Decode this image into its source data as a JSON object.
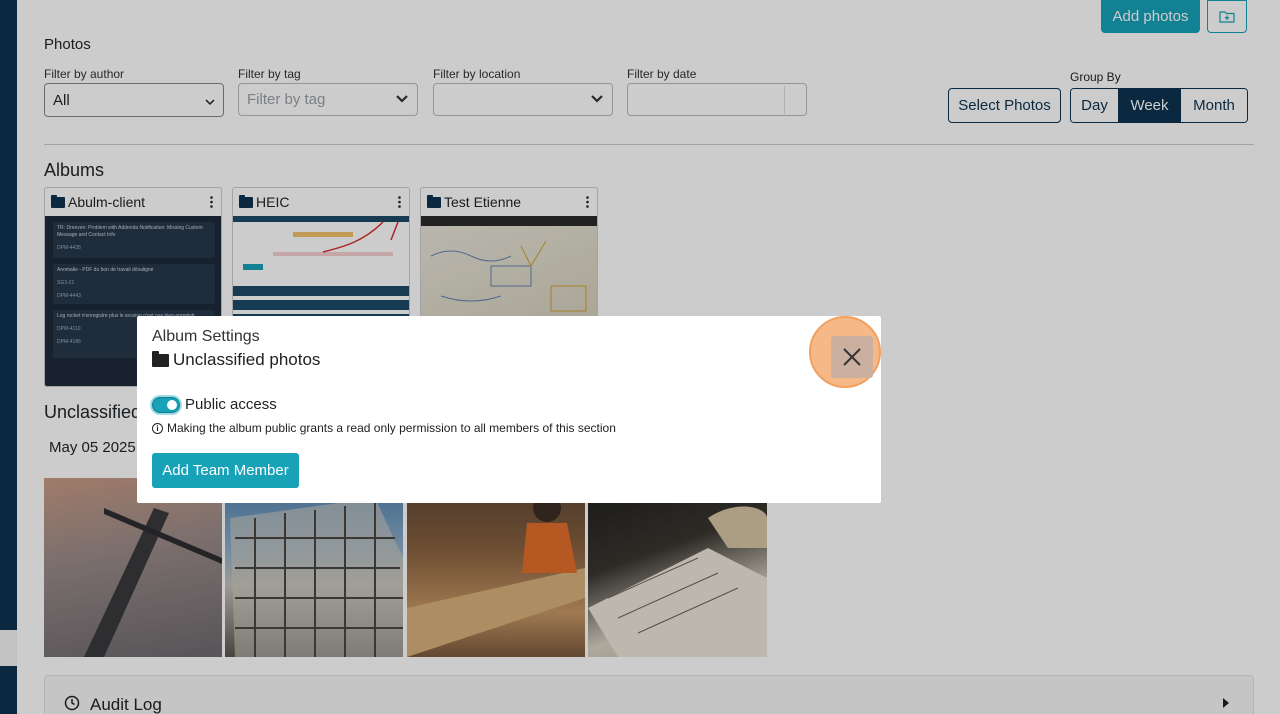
{
  "header": {
    "add_photos_label": "Add photos",
    "new_folder_icon": "folder-plus-icon"
  },
  "photos_section": {
    "title": "Photos",
    "filters": {
      "author": {
        "label": "Filter by author",
        "value": "All"
      },
      "tag": {
        "label": "Filter by tag",
        "placeholder": "Filter by tag"
      },
      "location": {
        "label": "Filter by location",
        "value": ""
      },
      "date": {
        "label": "Filter by date",
        "value": ""
      }
    },
    "select_photos_label": "Select Photos",
    "group_by": {
      "label": "Group By",
      "options": [
        "Day",
        "Week",
        "Month"
      ],
      "selected": "Week"
    }
  },
  "albums": {
    "title": "Albums",
    "items": [
      {
        "name": "Abulm-client"
      },
      {
        "name": "HEIC"
      },
      {
        "name": "Test Etienne"
      }
    ],
    "album1_preview": [
      {
        "title": "TR: Dreeven: Problem with Addenda Notification: Missing Custom Message and Contact Info",
        "code": "DPM-4435"
      },
      {
        "title": "Anomalie - PDF du bon de travail désaligné",
        "sub": "SG3-21",
        "code": "DPM-4443"
      },
      {
        "title": "Log rocket n'enregistre plus le session n'est pas bien enregistr",
        "code": "DPM-4110",
        "code2": "DPM-4186"
      }
    ]
  },
  "unclassified": {
    "title": "Unclassified",
    "date_label": "May 05 2025"
  },
  "audit_log": {
    "label": "Audit Log"
  },
  "modal": {
    "title": "Album Settings",
    "album_name": "Unclassified photos",
    "public_access_label": "Public access",
    "public_access_on": true,
    "info_text": "Making the album public grants a read only permission to all members of this section",
    "add_member_label": "Add Team Member"
  },
  "colors": {
    "primary": "#17a2b8",
    "navy": "#0d3450",
    "highlight": "#f6b886"
  }
}
